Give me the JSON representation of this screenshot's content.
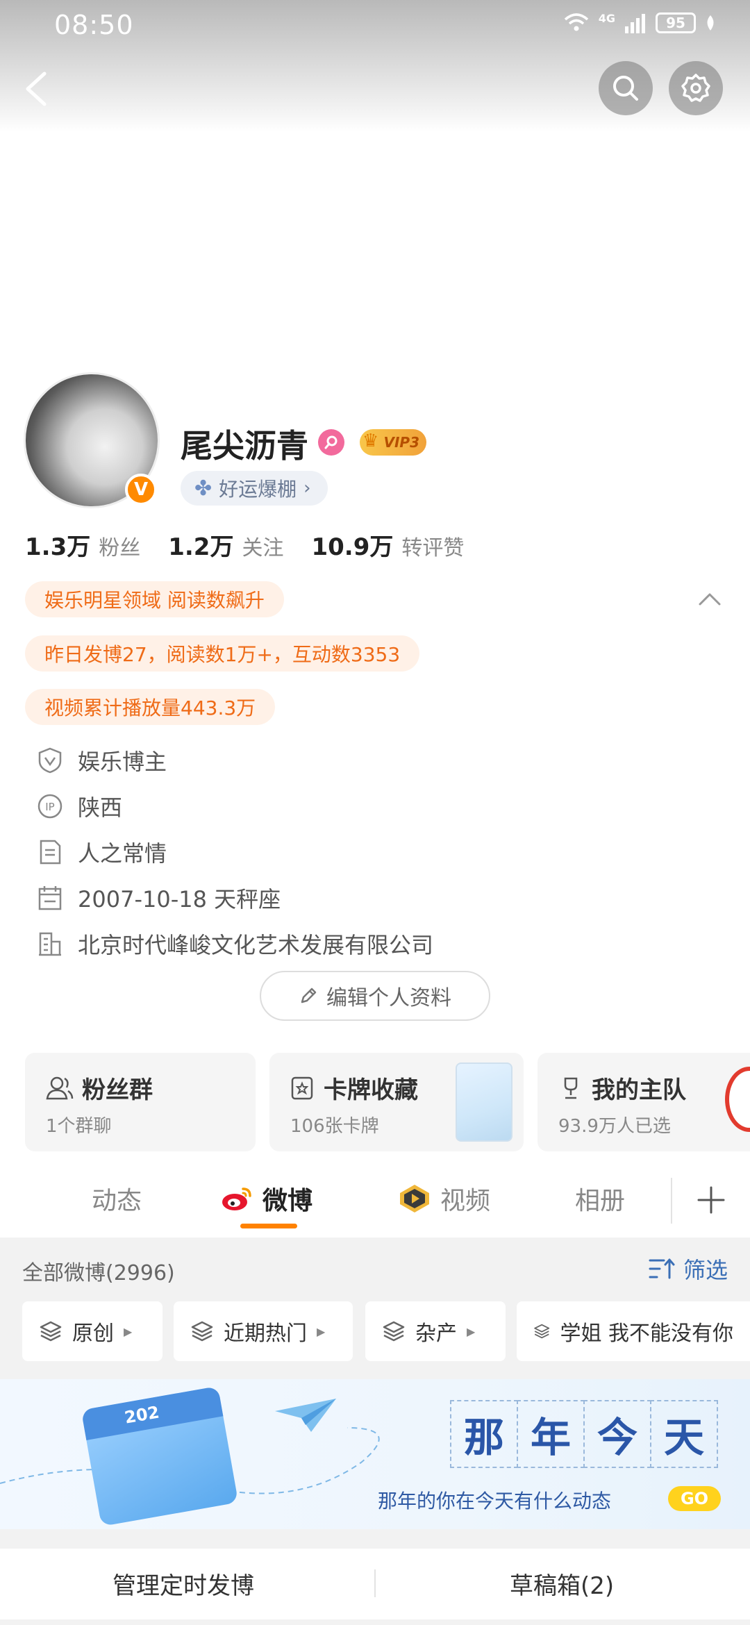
{
  "status_bar": {
    "time": "08:50",
    "network": "4G",
    "battery": "95"
  },
  "profile": {
    "username": "尾尖沥青",
    "vip_label": "VIP3",
    "lucky_label": "好运爆棚",
    "verified_label": "V",
    "stats": [
      {
        "value": "1.3万",
        "label": "粉丝"
      },
      {
        "value": "1.2万",
        "label": "关注"
      },
      {
        "value": "10.9万",
        "label": "转评赞"
      }
    ],
    "tags": [
      "娱乐明星领域 阅读数飙升",
      "昨日发博27，阅读数1万+，互动数3353",
      "视频累计播放量443.3万"
    ],
    "info": [
      {
        "icon": "shield-v-icon",
        "text": "娱乐博主"
      },
      {
        "icon": "ip-icon",
        "text": "陕西"
      },
      {
        "icon": "document-icon",
        "text": "人之常情"
      },
      {
        "icon": "calendar-icon",
        "text": "2007-10-18 天秤座"
      },
      {
        "icon": "building-icon",
        "text": "北京时代峰峻文化艺术发展有限公司"
      }
    ],
    "edit_label": "编辑个人资料"
  },
  "cards": [
    {
      "title": "粉丝群",
      "sub": "1个群聊",
      "icon": "fans-group-icon"
    },
    {
      "title": "卡牌收藏",
      "sub": "106张卡牌",
      "icon": "card-icon"
    },
    {
      "title": "我的主队",
      "sub": "93.9万人已选",
      "icon": "team-icon"
    }
  ],
  "tabs": [
    {
      "label": "动态",
      "active": false
    },
    {
      "label": "微博",
      "active": true
    },
    {
      "label": "视频",
      "active": false
    },
    {
      "label": "相册",
      "active": false
    }
  ],
  "feed": {
    "count_label": "全部微博(2996)",
    "filter_label": "筛选",
    "chips": [
      "原创",
      "近期热门",
      "杂产",
      "学姐 我不能没有你"
    ]
  },
  "banner": {
    "calendar_year": "202",
    "title_chars": [
      "那",
      "年",
      "今",
      "天"
    ],
    "slogan": "那年的你在今天有什么动态",
    "go_label": "GO"
  },
  "bottom_bar": {
    "left": "管理定时发博",
    "right": "草稿箱(2)"
  },
  "colors": {
    "accent_orange": "#ff8200",
    "tag_text": "#ef6b17",
    "tag_bg": "#fff1e7",
    "link_blue": "#3b6fb6"
  }
}
